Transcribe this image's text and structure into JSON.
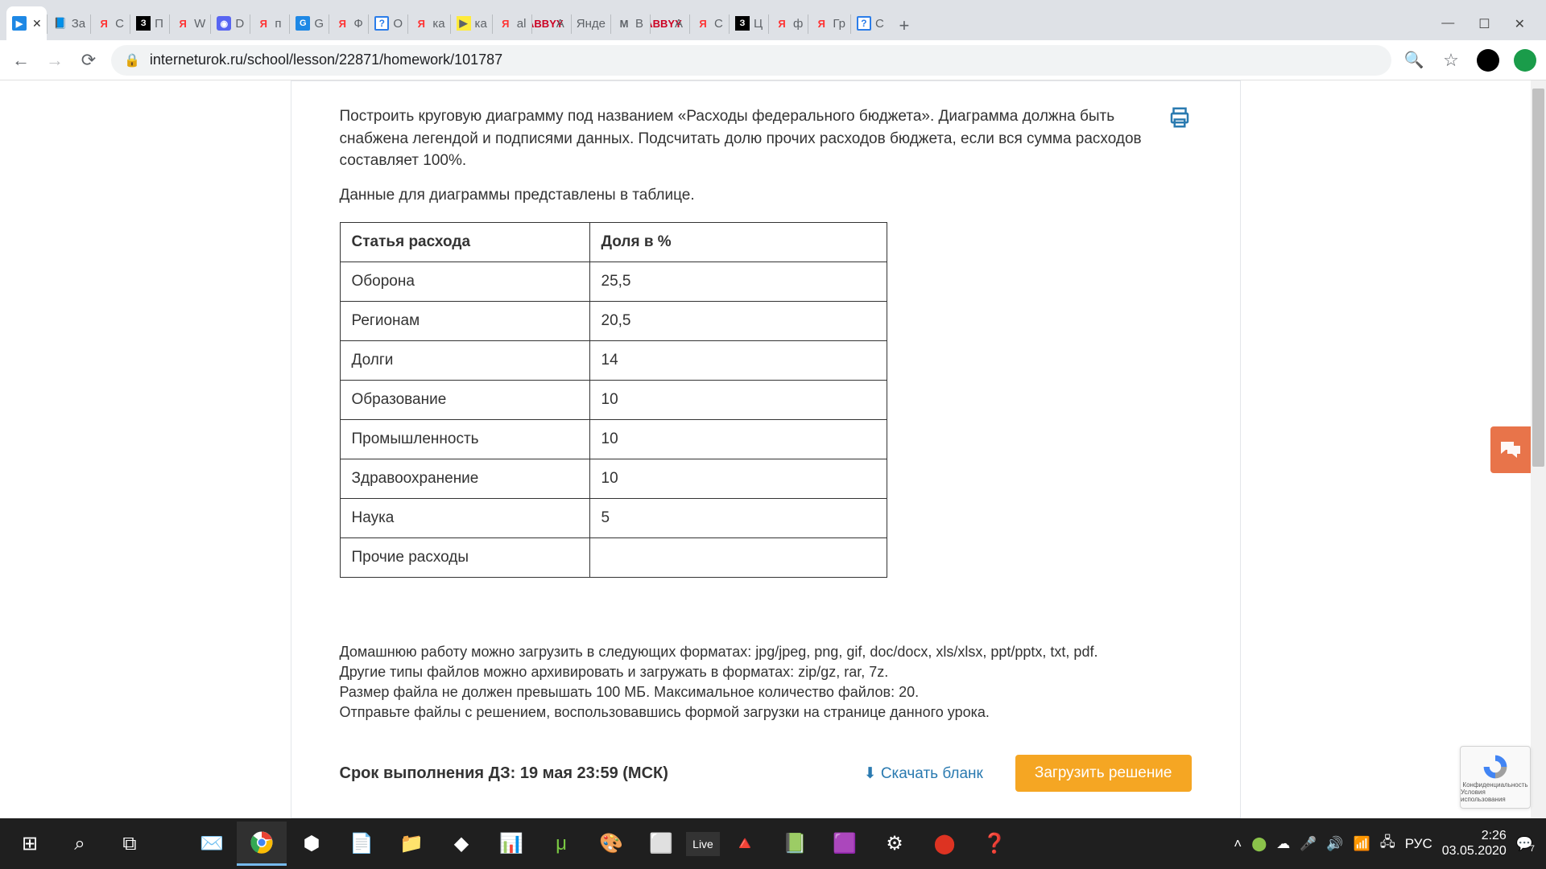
{
  "browser": {
    "tabs": [
      {
        "title": "x"
      },
      {
        "title": "За"
      },
      {
        "title": "С"
      },
      {
        "title": "П"
      },
      {
        "title": "W"
      },
      {
        "title": "D"
      },
      {
        "title": "п"
      },
      {
        "title": "G"
      },
      {
        "title": "Ф"
      },
      {
        "title": "О"
      },
      {
        "title": "ка"
      },
      {
        "title": "ка"
      },
      {
        "title": "al"
      },
      {
        "title": "А"
      },
      {
        "title": "Янде"
      },
      {
        "title": "В"
      },
      {
        "title": "А"
      },
      {
        "title": "С"
      },
      {
        "title": "Ц"
      },
      {
        "title": "ф"
      },
      {
        "title": "Гр"
      },
      {
        "title": "С"
      }
    ],
    "url": "interneturok.ru/school/lesson/22871/homework/101787"
  },
  "content": {
    "task_p1": "Построить круговую диаграмму под названием «Расходы федерального бюджета». Диаграмма должна быть снабжена легендой и подписями данных. Подсчитать долю прочих расходов бюджета, если вся сумма расходов составляет 100%.",
    "task_p2": "Данные для диаграммы представлены в таблице.",
    "table": {
      "headers": [
        "Статья расхода",
        "Доля в %"
      ],
      "rows": [
        [
          "Оборона",
          "25,5"
        ],
        [
          "Регионам",
          "20,5"
        ],
        [
          "Долги",
          "14"
        ],
        [
          "Образование",
          "10"
        ],
        [
          "Промышленность",
          "10"
        ],
        [
          "Здравоохранение",
          "10"
        ],
        [
          "Наука",
          "5"
        ],
        [
          "Прочие расходы",
          ""
        ]
      ]
    },
    "upload_l1": "Домашнюю работу можно загрузить в следующих форматах: jpg/jpeg, png, gif, doc/docx, xls/xlsx, ppt/pptx, txt, pdf.",
    "upload_l2": "Другие типы файлов можно архивировать и загружать в форматах: zip/gz, rar, 7z.",
    "upload_l3": "Размер файла не должен превышать 100 МБ. Максимальное количество файлов: 20.",
    "upload_l4": "Отправьте файлы с решением, воспользовавшись формой загрузки на странице данного урока.",
    "deadline": "Срок выполнения ДЗ: 19 мая 23:59 (МСК)",
    "download_label": "Скачать бланк",
    "upload_btn": "Загрузить решение"
  },
  "recaptcha": {
    "l1": "Конфиденциальность",
    "l2": "Условия использования"
  },
  "taskbar": {
    "lang": "РУС",
    "time": "2:26",
    "date": "03.05.2020",
    "notif": "7"
  }
}
